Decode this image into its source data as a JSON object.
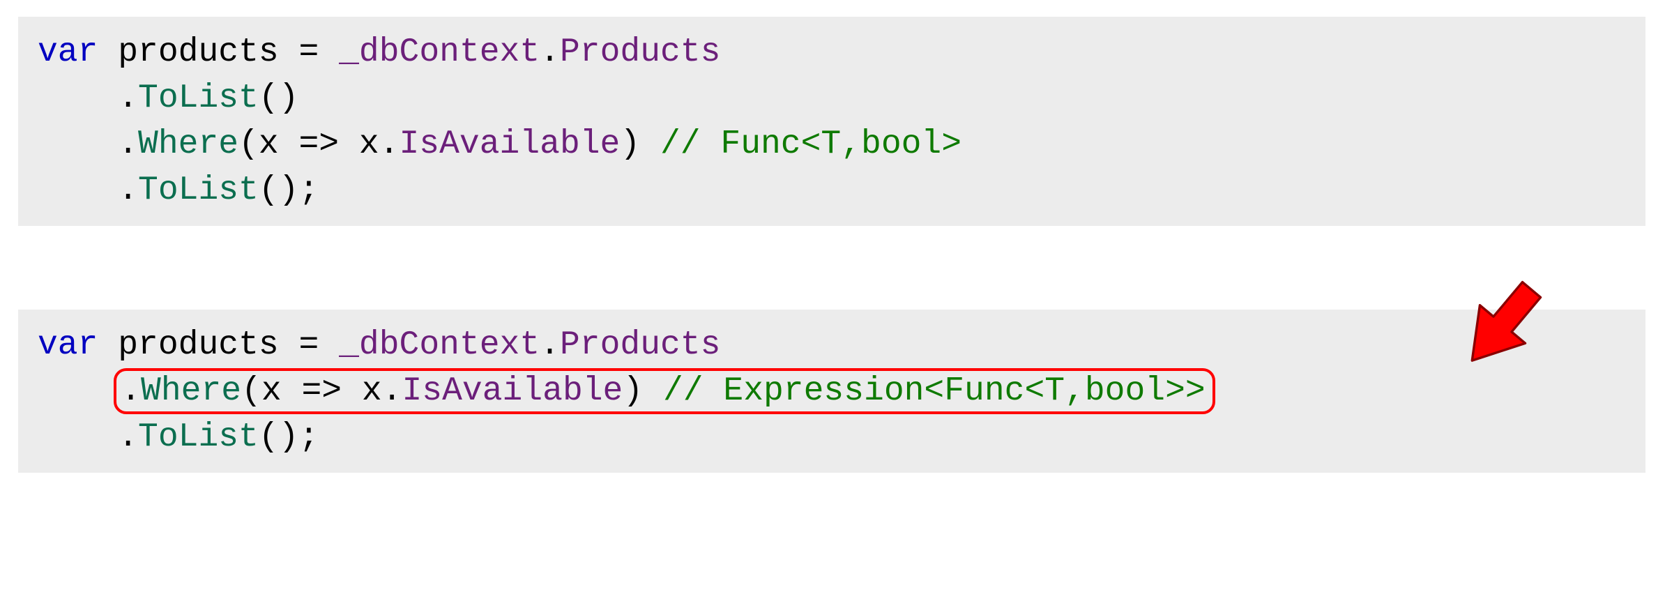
{
  "block1": {
    "l1": {
      "var": "var",
      "sp1": " ",
      "products": "products",
      "sp2": " ",
      "eq": "=",
      "sp3": " ",
      "db": "_dbContext",
      "dot": ".",
      "prod": "Products"
    },
    "l2": {
      "indent": "    ",
      "dot": ".",
      "tolist": "ToList",
      "paren": "()"
    },
    "l3": {
      "indent": "    ",
      "dot": ".",
      "where": "Where",
      "args": "(x => x.",
      "isavail": "IsAvailable",
      "close": ") ",
      "comment": "// Func<T,bool>"
    },
    "l4": {
      "indent": "    ",
      "dot": ".",
      "tolist": "ToList",
      "paren": "();"
    }
  },
  "block2": {
    "l1": {
      "var": "var",
      "sp1": " ",
      "products": "products",
      "sp2": " ",
      "eq": "=",
      "sp3": " ",
      "db": "_dbContext",
      "dot": ".",
      "prod": "Products"
    },
    "l2": {
      "indent": "    ",
      "dot": ".",
      "where": "Where",
      "args": "(x => x.",
      "isavail": "IsAvailable",
      "close": ") ",
      "comment": "// Expression<Func<T,bool>>"
    },
    "l3": {
      "indent": "    ",
      "dot": ".",
      "tolist": "ToList",
      "paren": "();"
    }
  }
}
